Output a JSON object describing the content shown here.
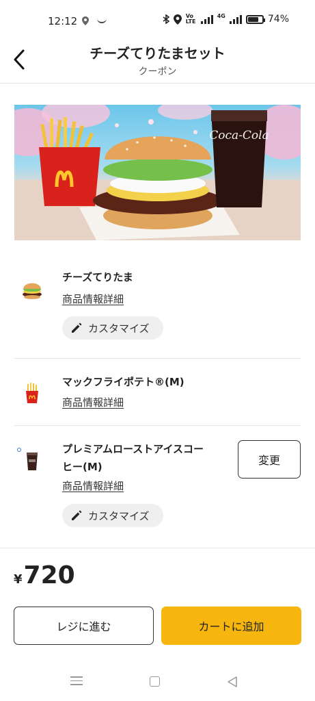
{
  "status_bar": {
    "time": "12:12",
    "battery_percent": "74%",
    "battery_level": 0.74,
    "network_label": "4G",
    "volte_label": "VoLTE"
  },
  "header": {
    "title": "チーズてりたまセット",
    "subtitle": "クーポン"
  },
  "items": [
    {
      "name": "チーズてりたま",
      "detail_link": "商品情報詳細",
      "customize_label": "カスタマイズ"
    },
    {
      "name": "マックフライポテト®(M)",
      "detail_link": "商品情報詳細"
    },
    {
      "name_line1": "プレミアムローストアイスコー",
      "name_line2": "ヒー(M)",
      "detail_link": "商品情報詳細",
      "customize_label": "カスタマイズ",
      "change_label": "変更"
    }
  ],
  "price": {
    "currency": "¥",
    "value": "720"
  },
  "actions": {
    "register_label": "レジに進む",
    "cart_label": "カートに追加"
  },
  "colors": {
    "accent_yellow": "#f6b60d",
    "mcd_red": "#d9221c",
    "mcd_yellow": "#ffc72c"
  },
  "icons": {
    "back": "chevron-left-icon",
    "customize": "pencil-icon",
    "nav_menu": "menu-icon",
    "nav_home": "home-square-icon",
    "nav_back": "triangle-back-icon"
  }
}
